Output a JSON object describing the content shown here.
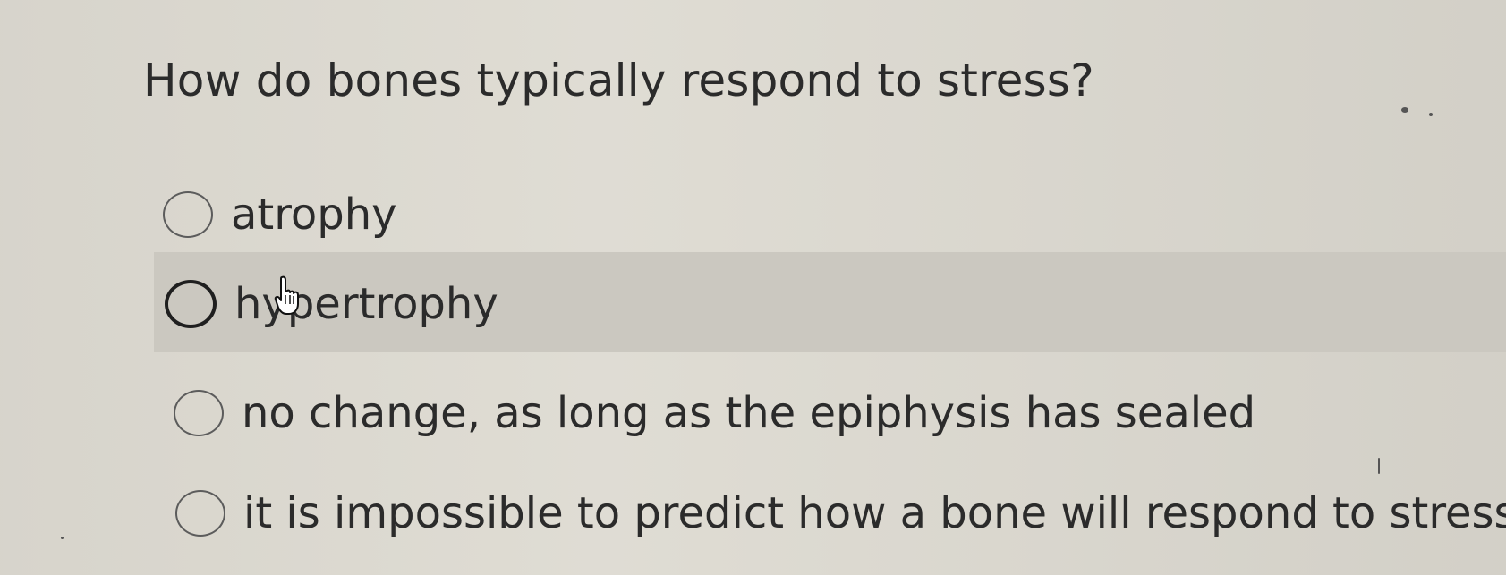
{
  "question": {
    "text": "How do bones typically respond to stress?"
  },
  "options": [
    {
      "label": "atrophy",
      "selected": false,
      "hovered": false
    },
    {
      "label": "hypertrophy",
      "selected": false,
      "hovered": true
    },
    {
      "label": "no change, as long as the epiphysis has sealed",
      "selected": false,
      "hovered": false
    },
    {
      "label": "it is impossible to predict how a bone will respond to stress",
      "selected": false,
      "hovered": false
    }
  ],
  "cursor": {
    "icon": "hand-pointer-icon"
  }
}
